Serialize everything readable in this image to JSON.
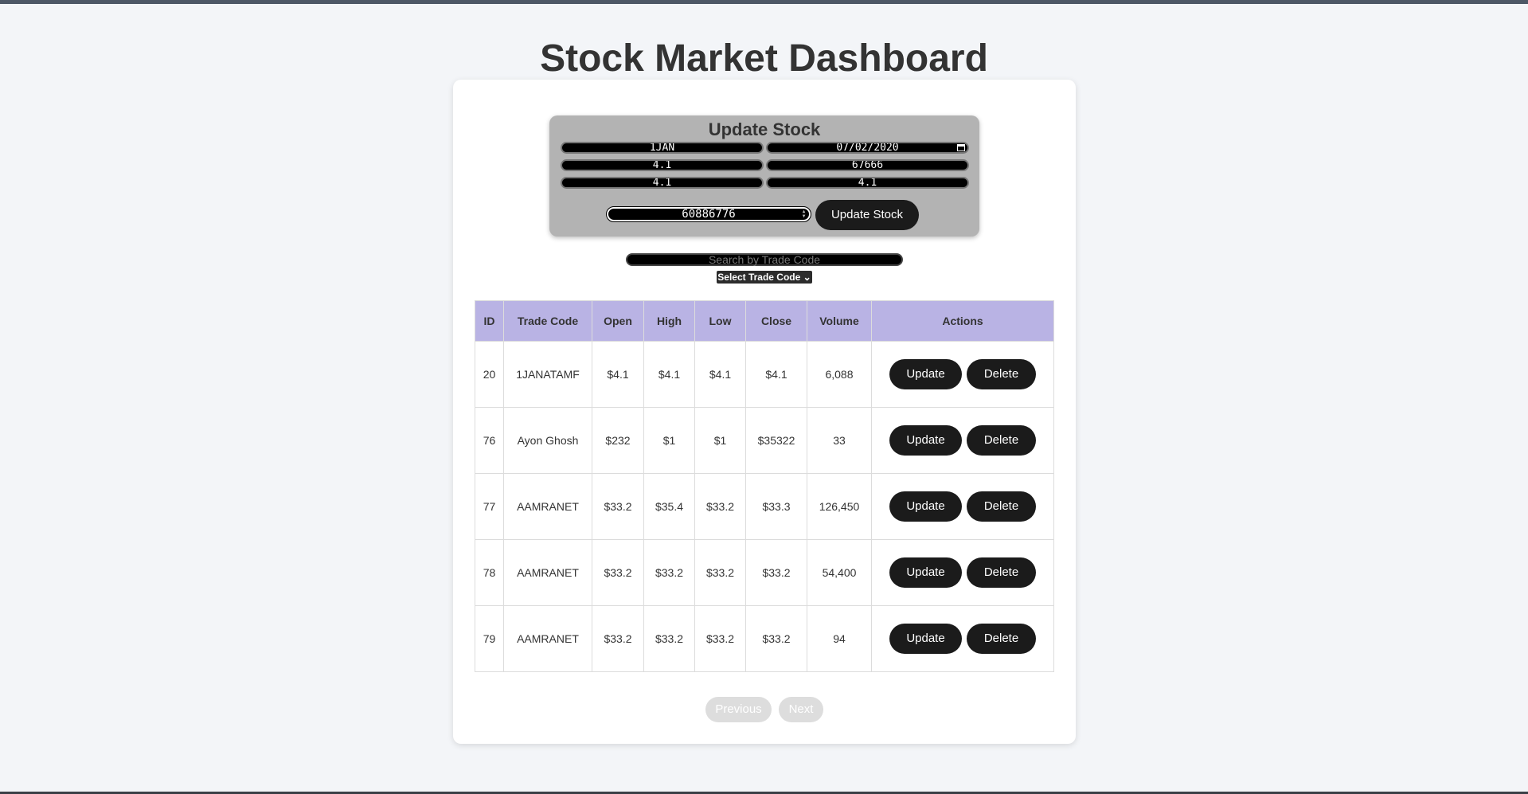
{
  "page": {
    "title": "Stock Market Dashboard"
  },
  "form": {
    "title": "Update Stock",
    "trade_code": "1JAN",
    "date": "07/02/2020",
    "open": "4.1",
    "high": "67666",
    "low": "4.1",
    "close": "4.1",
    "volume": "60886776",
    "submit_label": "Update Stock"
  },
  "search": {
    "placeholder": "Search by Trade Code"
  },
  "filter": {
    "selected": "Select Trade Code"
  },
  "table": {
    "headers": [
      "ID",
      "Trade Code",
      "Open",
      "High",
      "Low",
      "Close",
      "Volume",
      "Actions"
    ],
    "update_label": "Update",
    "delete_label": "Delete",
    "rows": [
      {
        "id": "20",
        "trade_code": "1JANATAMF",
        "open": "$4.1",
        "high": "$4.1",
        "low": "$4.1",
        "close": "$4.1",
        "volume": "6,088"
      },
      {
        "id": "76",
        "trade_code": "Ayon Ghosh",
        "open": "$232",
        "high": "$1",
        "low": "$1",
        "close": "$35322",
        "volume": "33"
      },
      {
        "id": "77",
        "trade_code": "AAMRANET",
        "open": "$33.2",
        "high": "$35.4",
        "low": "$33.2",
        "close": "$33.3",
        "volume": "126,450"
      },
      {
        "id": "78",
        "trade_code": "AAMRANET",
        "open": "$33.2",
        "high": "$33.2",
        "low": "$33.2",
        "close": "$33.2",
        "volume": "54,400"
      },
      {
        "id": "79",
        "trade_code": "AAMRANET",
        "open": "$33.2",
        "high": "$33.2",
        "low": "$33.2",
        "close": "$33.2",
        "volume": "94"
      }
    ]
  },
  "pagination": {
    "previous_label": "Previous",
    "next_label": "Next"
  },
  "colors": {
    "header_bg": "#b9b3e4",
    "button_dark": "#1b1b1b",
    "form_bg": "#b3b3b3"
  }
}
